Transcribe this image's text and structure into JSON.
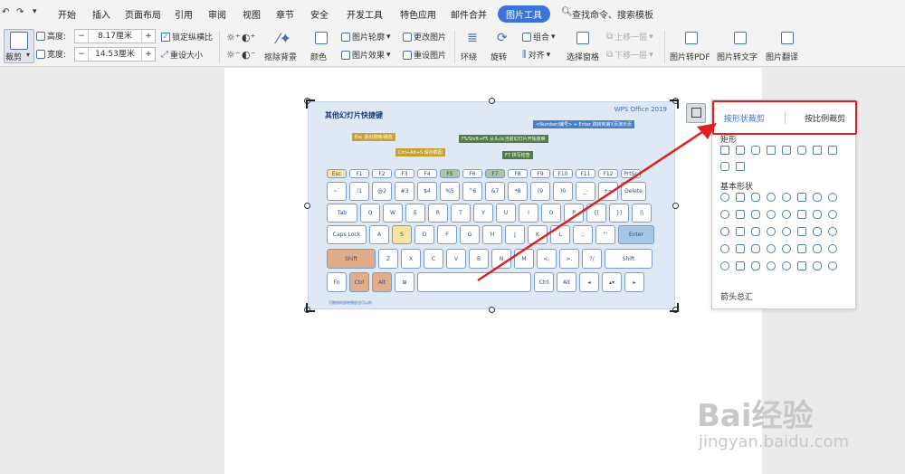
{
  "menubar": {
    "tabs": [
      "开始",
      "插入",
      "页面布局",
      "引用",
      "审阅",
      "视图",
      "章节",
      "安全",
      "开发工具",
      "特色应用",
      "邮件合并",
      "图片工具"
    ],
    "active_tab": "图片工具",
    "search_label": "查找命令、搜索模板"
  },
  "ribbon": {
    "crop_label": "裁剪",
    "height_label": "高度:",
    "height_value": "8.17厘米",
    "width_label": "宽度:",
    "width_value": "14.53厘米",
    "lock_ratio_label": "锁定纵横比",
    "reset_size_label": "重设大小",
    "remove_bg_label": "抠除背景",
    "color_label": "颜色",
    "outline_label": "图片轮廓",
    "effect_label": "图片效果",
    "change_pic_label": "更改图片",
    "reset_pic_label": "重设图片",
    "wrap_label": "环绕",
    "rotate_label": "旋转",
    "group_label": "组合",
    "align_label": "对齐",
    "selection_pane_label": "选择窗格",
    "bring_forward_label": "上移一层",
    "send_backward_label": "下移一层",
    "to_pdf_label": "图片转PDF",
    "to_text_label": "图片转文字",
    "translate_label": "图片翻译"
  },
  "keyboard_image": {
    "title": "其他幻灯片快捷键",
    "brand": "WPS Office 2019",
    "tips": [
      "Esc 退出放映/播放",
      "Ctrl+Alt+S 保存截图",
      "F5/Shift+F5 从头/从当前幻灯片开始放映",
      "F7 拼写检查",
      "<Number/编号> + Enter 跳转到第X页演示页"
    ],
    "footer": "可撤销的放映播放也可以的",
    "rows": [
      [
        "Esc",
        "F1",
        "F2",
        "F3",
        "F4",
        "F5",
        "F6",
        "F7",
        "F8",
        "F9",
        "F10",
        "F11",
        "F12",
        "PrtSc"
      ],
      [
        "~`",
        "!1",
        "@2",
        "#3",
        "$4",
        "%5",
        "^6",
        "&7",
        "*8",
        "(9",
        ")0",
        "_-",
        "+=",
        "Delete"
      ],
      [
        "Tab",
        "Q",
        "W",
        "E",
        "R",
        "T",
        "Y",
        "U",
        "I",
        "O",
        "P",
        "{[",
        "}]",
        "|\\"
      ],
      [
        "Caps Lock",
        "A",
        "S",
        "D",
        "F",
        "G",
        "H",
        "J",
        "K",
        "L",
        ":;",
        "\"'",
        "Enter"
      ],
      [
        "Shift",
        "Z",
        "X",
        "C",
        "V",
        "B",
        "N",
        "M",
        "<,",
        ">.",
        "?/",
        "Shift"
      ],
      [
        "Fn",
        "Ctrl",
        "Alt",
        "⊞",
        "",
        "Ctrl",
        "Alt",
        "◂",
        "▴▾",
        "▸"
      ]
    ]
  },
  "crop_panel": {
    "tab_shape": "按形状裁剪",
    "tab_ratio": "按比例裁剪",
    "section_rect": "矩形",
    "section_basic": "基本形状",
    "section_arrow": "箭头总汇"
  },
  "watermark": {
    "brand": "Bai经验",
    "url": "jingyan.baidu.com"
  },
  "colors": {
    "accent": "#3a73d9",
    "highlight": "#e02020"
  }
}
